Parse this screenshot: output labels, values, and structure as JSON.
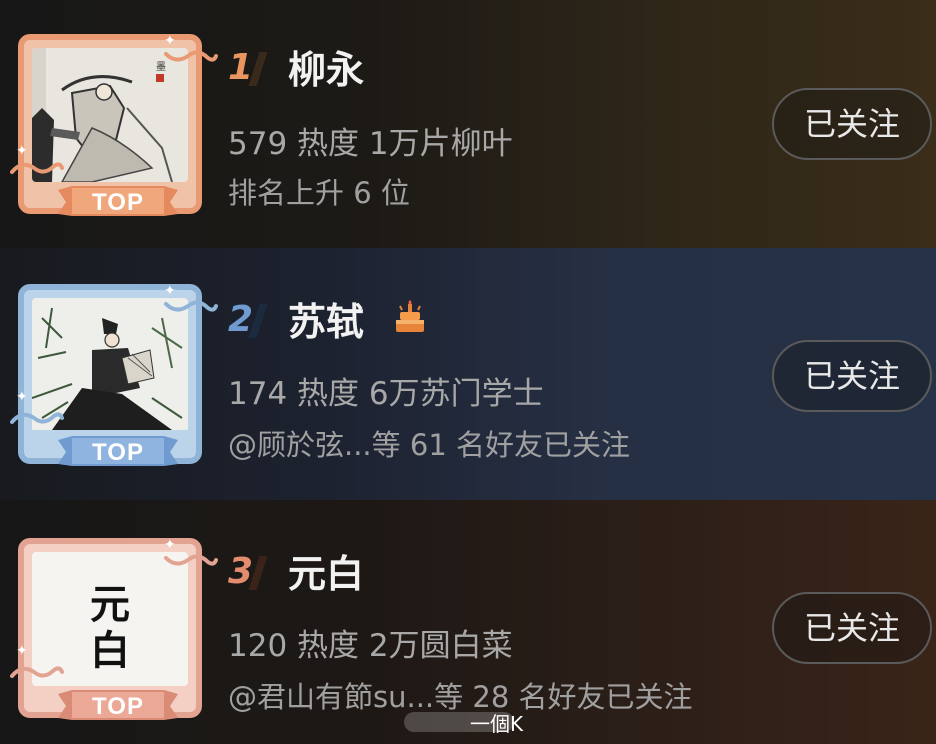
{
  "rows": [
    {
      "rank": "1",
      "name": "柳永",
      "stats": "579 热度 1万片柳叶",
      "sub": "排名上升 6 位",
      "follow_label": "已关注",
      "badge": "TOP",
      "frame_color": "#e99a73"
    },
    {
      "rank": "2",
      "name": "苏轼",
      "stats": "174 热度 6万苏门学士",
      "sub": "@顾於弦...等 61 名好友已关注",
      "follow_label": "已关注",
      "badge": "TOP",
      "frame_color": "#8fb4d8"
    },
    {
      "rank": "3",
      "name": "元白",
      "stats": "120 热度 2万圆白菜",
      "sub": "@君山有節su...等 28 名好友已关注",
      "follow_label": "已关注",
      "badge": "TOP",
      "frame_color": "#e3a392",
      "avatar_calligraphy": [
        "元",
        "白"
      ]
    }
  ],
  "watermark": "一個K"
}
